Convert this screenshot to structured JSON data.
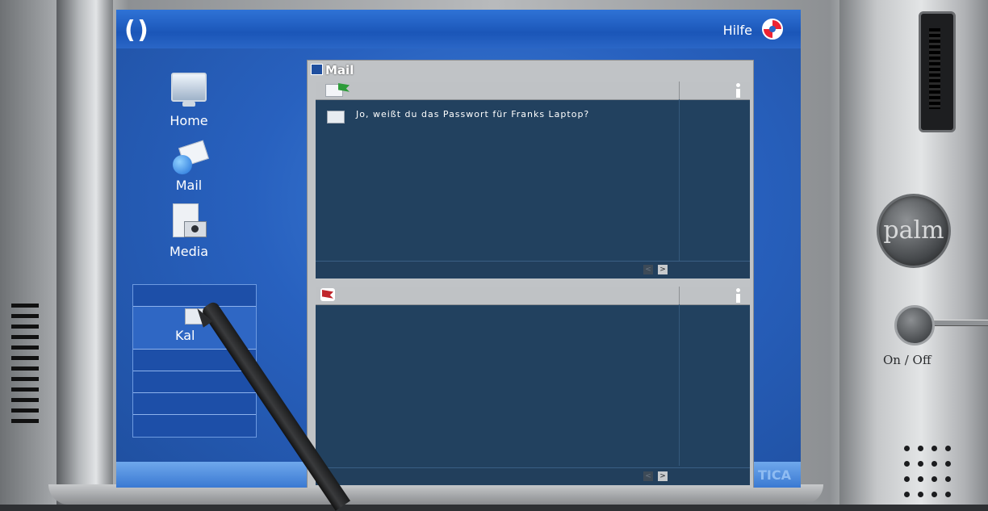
{
  "header": {
    "logo_icon": "cycle-logo-icon",
    "help_label": "Hilfe",
    "help_icon": "lifebuoy-icon"
  },
  "sidebar": {
    "items": [
      {
        "label": "Home",
        "icon": "monitor-icon"
      },
      {
        "label": "Mail",
        "icon": "mail-globe-icon"
      },
      {
        "label": "Media",
        "icon": "media-camera-icon"
      }
    ],
    "submenu_active_label": "Kal"
  },
  "mail_window": {
    "title": "Mail",
    "inbox": {
      "messages": [
        {
          "text": "Jo, weißt du das Passwort für Franks Laptop?"
        }
      ],
      "prev_label": "<",
      "next_label": ">"
    },
    "outbox": {
      "messages": [],
      "prev_label": "<",
      "next_label": ">"
    }
  },
  "footer": {
    "brand_fragment": "TICA"
  },
  "device": {
    "brand": "palm",
    "power_label": "On / Off"
  },
  "colors": {
    "screen_blue": "#2861bf",
    "pane_bg": "#22415f",
    "window_gray": "#c0c3c6"
  }
}
